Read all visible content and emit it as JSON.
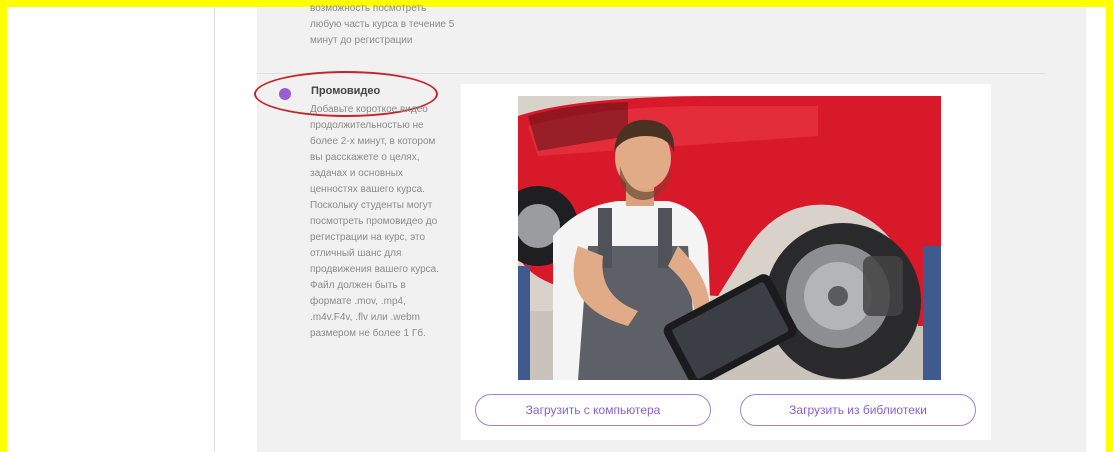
{
  "top_section": {
    "description_tail": "возможность посмотреть любую часть курса в течение 5 минут до регистрации"
  },
  "promo": {
    "title": "Промовидео",
    "description": "Добавьте короткое видео продолжительностью не более 2-х минут, в котором вы расскажете о целях, задачах и основных ценностях вашего курса. Поскольку студенты могут посмотреть промовидео до регистрации на курс, это отличный шанс для продвижения вашего курса. Файл должен быть в формате .mov, .mp4, .m4v.F4v, .flv или .webm размером не более 1 Гб."
  },
  "buttons": {
    "upload_computer": "Загрузить с компьютера",
    "upload_library": "Загрузить из библиотеки"
  },
  "colors": {
    "accent": "#9a5dd4",
    "annotation": "#c2262b",
    "frame": "#ffff00"
  }
}
